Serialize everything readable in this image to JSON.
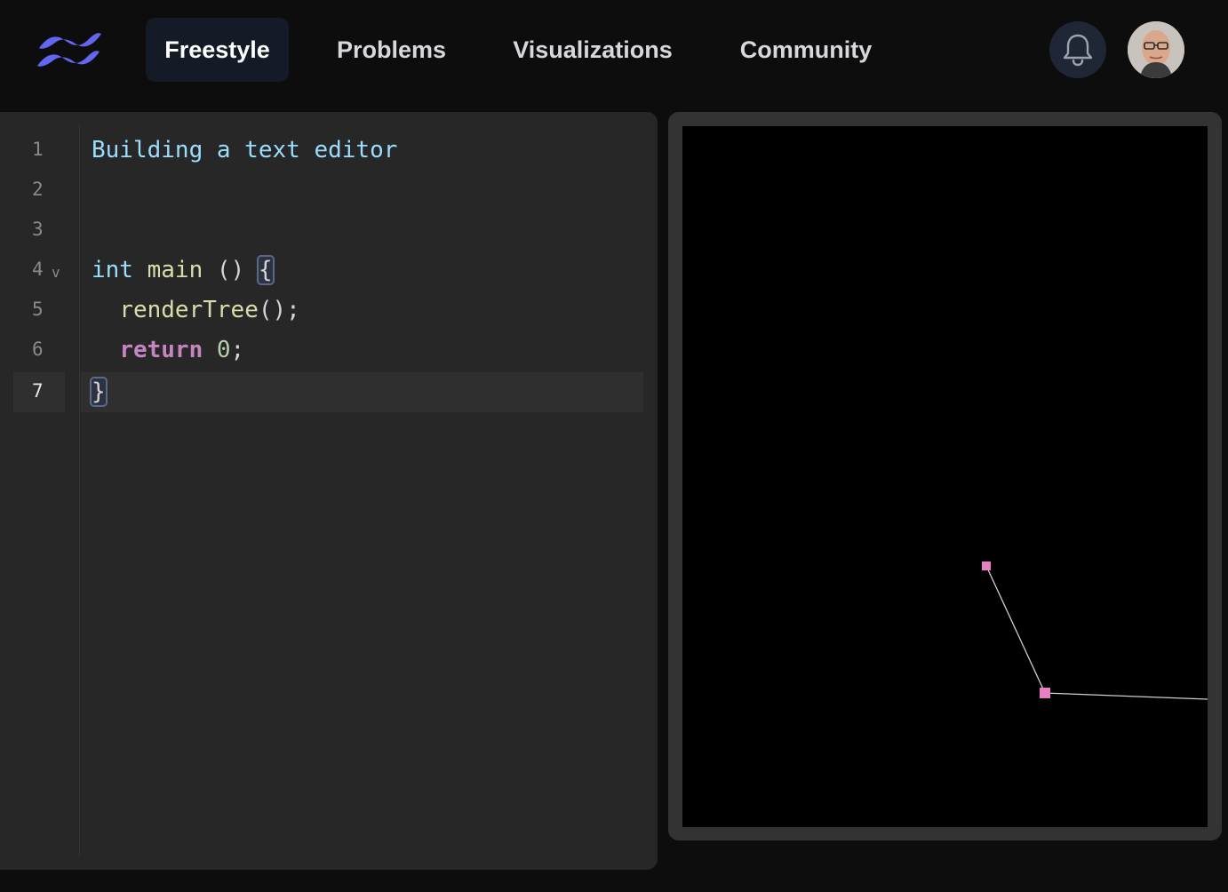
{
  "nav": {
    "tabs": [
      {
        "label": "Freestyle",
        "active": true
      },
      {
        "label": "Problems",
        "active": false
      },
      {
        "label": "Visualizations",
        "active": false
      },
      {
        "label": "Community",
        "active": false
      }
    ],
    "logo_icon": "wave-logo-icon",
    "logo_color": "#6366f1",
    "notification_icon": "bell-icon",
    "avatar_icon": "user-avatar"
  },
  "editor": {
    "current_line": 7,
    "lines": [
      {
        "number": "1",
        "text": "Building a text editor"
      },
      {
        "number": "2",
        "text": ""
      },
      {
        "number": "3",
        "text": ""
      },
      {
        "number": "4",
        "text": "int main () {",
        "fold_marker": "v"
      },
      {
        "number": "5",
        "text": "  renderTree();"
      },
      {
        "number": "6",
        "text": "  return 0;"
      },
      {
        "number": "7",
        "text": "}"
      }
    ]
  },
  "visualization": {
    "background": "#000000",
    "node_color": "#e87fc4",
    "edge_color": "#cfcfcf"
  }
}
